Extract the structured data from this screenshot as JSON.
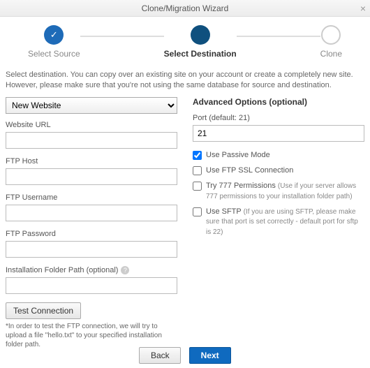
{
  "title": "Clone/Migration Wizard",
  "steps": {
    "s1": "Select Source",
    "s2": "Select Destination",
    "s3": "Clone",
    "check": "✓"
  },
  "intro": "Select destination. You can copy over an existing site on your account or create a completely new site. However, please make sure that you're not using the same database for source and destination.",
  "left": {
    "site_select": "New Website",
    "url_label": "Website URL",
    "url_value": "",
    "host_label": "FTP Host",
    "host_value": "",
    "user_label": "FTP Username",
    "user_value": "",
    "pass_label": "FTP Password",
    "pass_value": "",
    "path_label": "Installation Folder Path (optional)",
    "path_value": "",
    "test_btn": "Test Connection",
    "test_note": "*In order to test the FTP connection, we will try to upload a file \"hello.txt\" to your specified installation folder path."
  },
  "right": {
    "heading": "Advanced Options (optional)",
    "port_label": "Port (default: 21)",
    "port_value": "21",
    "passive": "Use Passive Mode",
    "ssl": "Use FTP SSL Connection",
    "try777": "Try 777 Permissions",
    "try777_hint": "(Use if your server allows 777 permissions to your installation folder path)",
    "sftp": "Use SFTP",
    "sftp_hint": "(If you are using SFTP, please make sure that port is set correctly - default port for sftp is 22)"
  },
  "footer": {
    "back": "Back",
    "next": "Next"
  }
}
